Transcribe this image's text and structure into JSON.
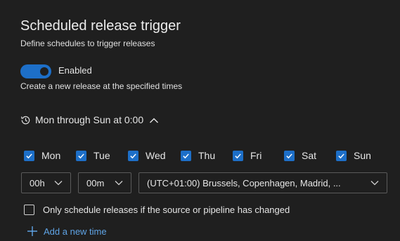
{
  "header": {
    "title": "Scheduled release trigger",
    "subtitle": "Define schedules to trigger releases"
  },
  "toggle": {
    "label": "Enabled",
    "on": true,
    "description": "Create a new release at the specified times"
  },
  "schedule": {
    "summary": "Mon through Sun at 0:00",
    "expanded": true,
    "days": [
      {
        "label": "Mon",
        "checked": true
      },
      {
        "label": "Tue",
        "checked": true
      },
      {
        "label": "Wed",
        "checked": true
      },
      {
        "label": "Thu",
        "checked": true
      },
      {
        "label": "Fri",
        "checked": true
      },
      {
        "label": "Sat",
        "checked": true
      },
      {
        "label": "Sun",
        "checked": true
      }
    ],
    "hour": "00h",
    "minute": "00m",
    "timezone": "(UTC+01:00) Brussels, Copenhagen, Madrid, ...",
    "only_if_changed_label": "Only schedule releases if the source or pipeline has changed",
    "only_if_changed": false,
    "add_time_label": "Add a new time"
  },
  "colors": {
    "accent": "#1d6fc8",
    "link": "#5fa4e6",
    "background": "#1f1f1f"
  }
}
